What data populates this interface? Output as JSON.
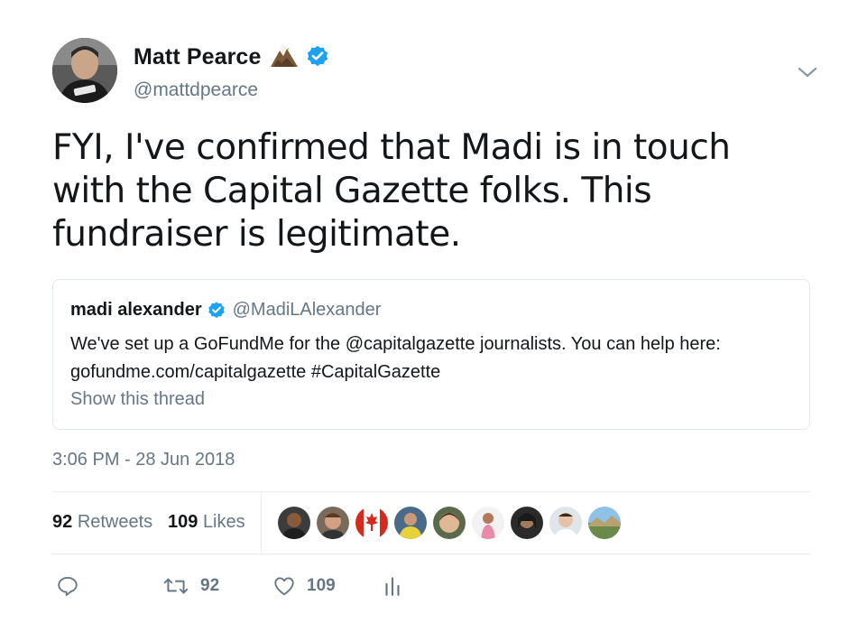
{
  "author": {
    "display_name": "Matt Pearce",
    "handle": "@mattdpearce",
    "emoji_icon": "eagle-icon",
    "verified_icon": "verified-badge-icon",
    "verified_color": "#1da1f2"
  },
  "tweet": {
    "text": "FYI, I've confirmed that Madi is in touch with the Capital Gazette folks. This fundraiser is legitimate.",
    "timestamp": "3:06 PM - 28 Jun 2018"
  },
  "quoted": {
    "name": "madi alexander",
    "handle": "@MadiLAlexander",
    "text_line1": "We've set up a GoFundMe for the @capitalgazette journalists. You can help here:",
    "text_line2": "gofundme.com/capitalgazette #CapitalGazette",
    "show_thread": "Show this thread"
  },
  "stats": {
    "retweets_count": "92",
    "retweets_label": "Retweets",
    "likes_count": "109",
    "likes_label": "Likes",
    "likers_avatar_count": 9
  },
  "actions": {
    "reply_icon": "reply-icon",
    "retweet_icon": "retweet-icon",
    "retweet_count": "92",
    "like_icon": "heart-icon",
    "like_count": "109",
    "analytics_icon": "analytics-icon"
  },
  "colors": {
    "text": "#14171a",
    "muted": "#657786",
    "border": "#e1e8ed",
    "accent": "#1da1f2"
  }
}
